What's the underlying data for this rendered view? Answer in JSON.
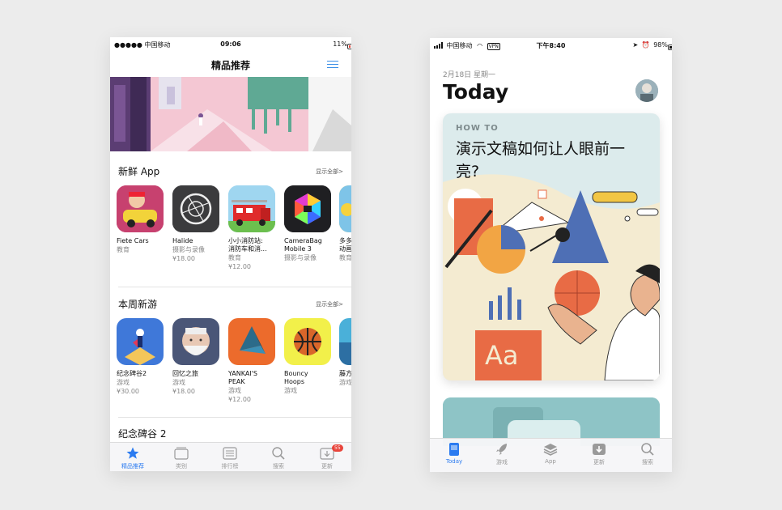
{
  "left": {
    "status": {
      "carrier": "●●●●● 中国移动",
      "time": "09:06",
      "battery": "11%"
    },
    "nav_title": "精品推荐",
    "sections": [
      {
        "title": "新鲜 App",
        "see_all": "显示全部>",
        "apps": [
          {
            "name": "Fiete Cars",
            "category": "教育",
            "price": ""
          },
          {
            "name": "Halide",
            "category": "摄影与录像",
            "price": "¥18.00"
          },
          {
            "name": "小小消防站:",
            "name2": "消防车和消...",
            "category": "教育",
            "price": "¥12.00"
          },
          {
            "name": "CameraBag",
            "name2": "Mobile 3",
            "category": "摄影与录像",
            "price": ""
          },
          {
            "name": "多多",
            "name2": "动画",
            "category": "教育",
            "price": ""
          }
        ]
      },
      {
        "title": "本周新游",
        "see_all": "显示全部>",
        "apps": [
          {
            "name": "纪念碑谷2",
            "category": "游戏",
            "price": "¥30.00"
          },
          {
            "name": "回忆之旅",
            "category": "游戏",
            "price": "¥18.00"
          },
          {
            "name": "YANKAI'S",
            "name2": "PEAK",
            "category": "游戏",
            "price": "¥12.00"
          },
          {
            "name": "Bouncy",
            "name2": "Hoops",
            "category": "游戏",
            "price": ""
          },
          {
            "name": "藤方",
            "category": "游戏",
            "price": ""
          }
        ]
      },
      {
        "title": "纪念碑谷 2"
      }
    ],
    "tabs": [
      {
        "label": "精品推荐",
        "icon": "star-icon",
        "active": true
      },
      {
        "label": "类别",
        "icon": "categories-icon"
      },
      {
        "label": "排行榜",
        "icon": "list-icon"
      },
      {
        "label": "搜索",
        "icon": "search-icon"
      },
      {
        "label": "更新",
        "icon": "updates-icon",
        "badge": "55"
      }
    ]
  },
  "right": {
    "status": {
      "carrier": "中国移动",
      "vpn": "VPN",
      "time": "下午8:40",
      "battery": "98%"
    },
    "date": "2月18日 星期一",
    "heading": "Today",
    "card": {
      "kicker": "HOW TO",
      "title": "演示文稿如何让人眼前一亮?"
    },
    "tabs": [
      {
        "label": "Today",
        "icon": "today-icon",
        "active": true
      },
      {
        "label": "游戏",
        "icon": "rocket-icon"
      },
      {
        "label": "App",
        "icon": "apps-stack-icon"
      },
      {
        "label": "更新",
        "icon": "download-icon"
      },
      {
        "label": "搜索",
        "icon": "search-icon"
      }
    ]
  },
  "colors": {
    "accent": "#2b7bf0",
    "badge": "#e8453c",
    "battery_low": "#e8453c"
  }
}
